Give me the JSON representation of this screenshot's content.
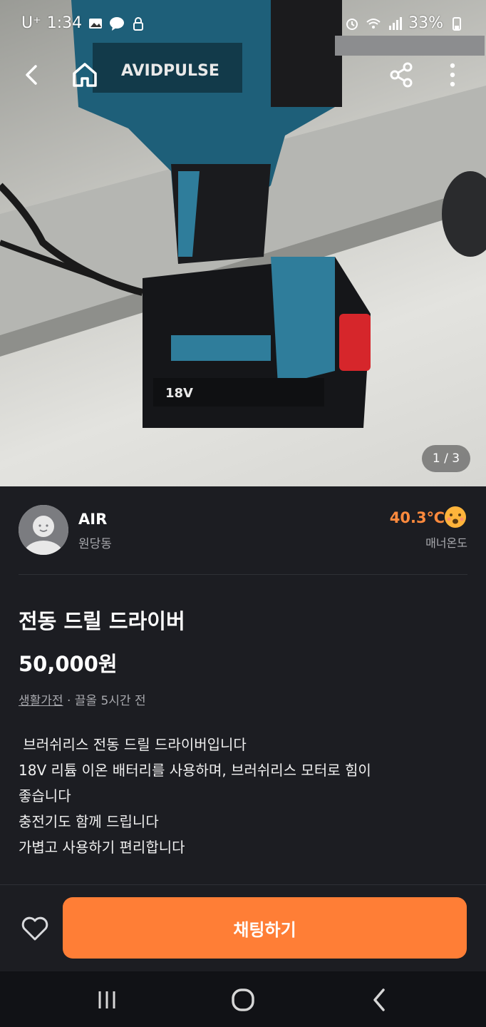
{
  "statusbar": {
    "carrier": "U⁺",
    "time": "1:34",
    "battery": "33%"
  },
  "gallery": {
    "counter": "1 / 3",
    "brand_text": "AVIDPULSE",
    "battery_text": "18V"
  },
  "seller": {
    "name": "AIR",
    "location": "원당동",
    "temperature": "40.3℃",
    "temperature_label": "매너온도"
  },
  "listing": {
    "title": "전동 드릴 드라이버",
    "price": "50,000원",
    "category": "생활가전",
    "time_info": " · 끌올 5시간 전",
    "description": [
      " 브러쉬리스 전동 드릴 드라이버입니다",
      "18V 리튬 이온 배터리를 사용하며, 브러쉬리스 모터로 힘이",
      "좋습니다",
      "충전기도 함께 드립니다",
      "가볍고 사용하기 편리합니다"
    ]
  },
  "actions": {
    "chat_label": "채팅하기"
  },
  "colors": {
    "accent": "#ff7e36",
    "temperature": "#ff8a3d",
    "background": "#1c1d22"
  }
}
